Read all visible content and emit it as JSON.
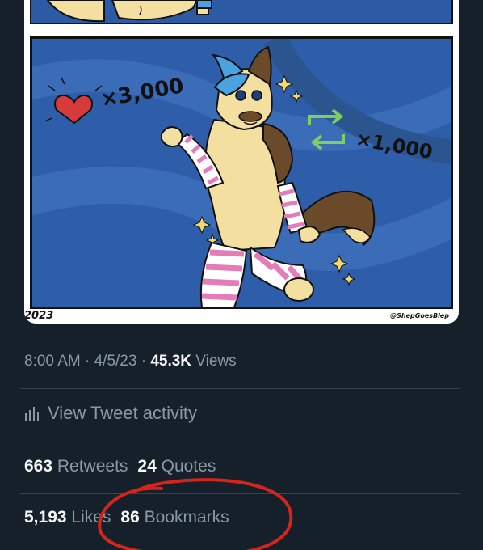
{
  "image": {
    "year": "2023",
    "credit": "@ShepGoesBlep",
    "likes_caption": "×3,000",
    "retweets_caption": "×1,000"
  },
  "tweet": {
    "time": "8:00 AM",
    "separator": " · ",
    "date": "4/5/23",
    "separator2": " · ",
    "views_count": "45.3K",
    "views_label": " Views"
  },
  "activity": {
    "label": "View Tweet activity",
    "icon": "analytics-bars-icon"
  },
  "engagement": {
    "retweets_count": "663",
    "retweets_label": " Retweets",
    "quotes_count": "24",
    "quotes_label": " Quotes",
    "likes_count": "5,193",
    "likes_label": " Likes",
    "bookmarks_count": "86",
    "bookmarks_label": " Bookmarks"
  },
  "colors": {
    "background": "#15202b",
    "text_primary": "#f7f9f9",
    "text_secondary": "#8b98a5",
    "divider": "#38444d",
    "annotation_circle": "#d7241b",
    "artwork_blue": "#2e5ea9"
  }
}
